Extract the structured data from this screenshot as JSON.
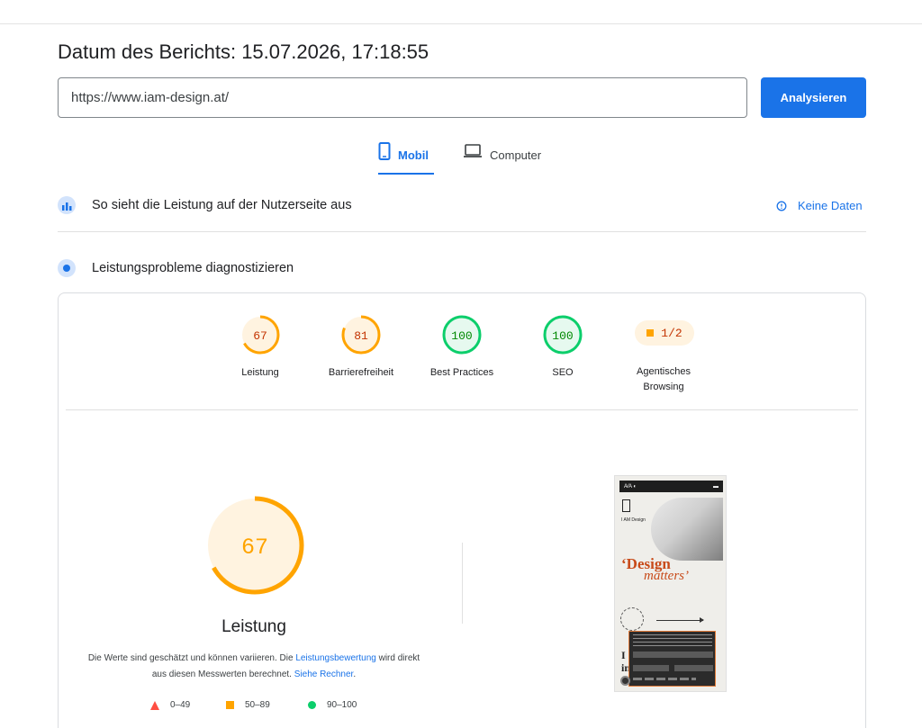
{
  "report": {
    "date_label": "Datum des Berichts: 15.07.2026, 17:18:55"
  },
  "search": {
    "url_value": "https://www.iam-design.at/",
    "analyze_label": "Analysieren"
  },
  "tabs": [
    {
      "label": "Mobil",
      "icon": "smartphone-icon",
      "active": true
    },
    {
      "label": "Computer",
      "icon": "laptop-icon",
      "active": false
    }
  ],
  "field_data": {
    "title": "So sieht die Leistung auf der Nutzerseite aus",
    "no_data_label": "Keine Daten"
  },
  "diagnose": {
    "title": "Leistungsprobleme diagnostizieren"
  },
  "gauges": [
    {
      "score": "67",
      "label": "Leistung",
      "color": "#ffa400",
      "fill": "#fff3e0",
      "text_color": "#c33300",
      "value": 67
    },
    {
      "score": "81",
      "label": "Barrierefreiheit",
      "color": "#ffa400",
      "fill": "#fff3e0",
      "text_color": "#c33300",
      "value": 81
    },
    {
      "score": "100",
      "label": "Best Practices",
      "color": "#0cce6b",
      "fill": "#e6f9ef",
      "text_color": "#008800",
      "value": 100
    },
    {
      "score": "100",
      "label": "SEO",
      "color": "#0cce6b",
      "fill": "#e6f9ef",
      "text_color": "#008800",
      "value": 100
    }
  ],
  "agentic": {
    "value": "1/2",
    "label_line1": "Agentisches",
    "label_line2": "Browsing"
  },
  "performance": {
    "score": "67",
    "value": 67,
    "title": "Leistung",
    "desc_part1": "Die Werte sind geschätzt und können variieren. Die ",
    "desc_link1": "Leistungsbewertung",
    "desc_part2": " wird direkt aus diesen Messwerten berechnet. ",
    "desc_link2": "Siehe Rechner",
    "desc_end": "."
  },
  "legend": [
    {
      "range": "0–49",
      "shape": "triangle",
      "color": "#ff4e42"
    },
    {
      "range": "50–89",
      "shape": "square",
      "color": "#ffa400"
    },
    {
      "range": "90–100",
      "shape": "circle",
      "color": "#0cce6b"
    }
  ],
  "screenshot": {
    "top_bar_left": "A⁄A ◐",
    "brand": "I AM Design",
    "headline1": "‘Design",
    "headline2": "matters’",
    "bottom_text": "I\nin"
  }
}
